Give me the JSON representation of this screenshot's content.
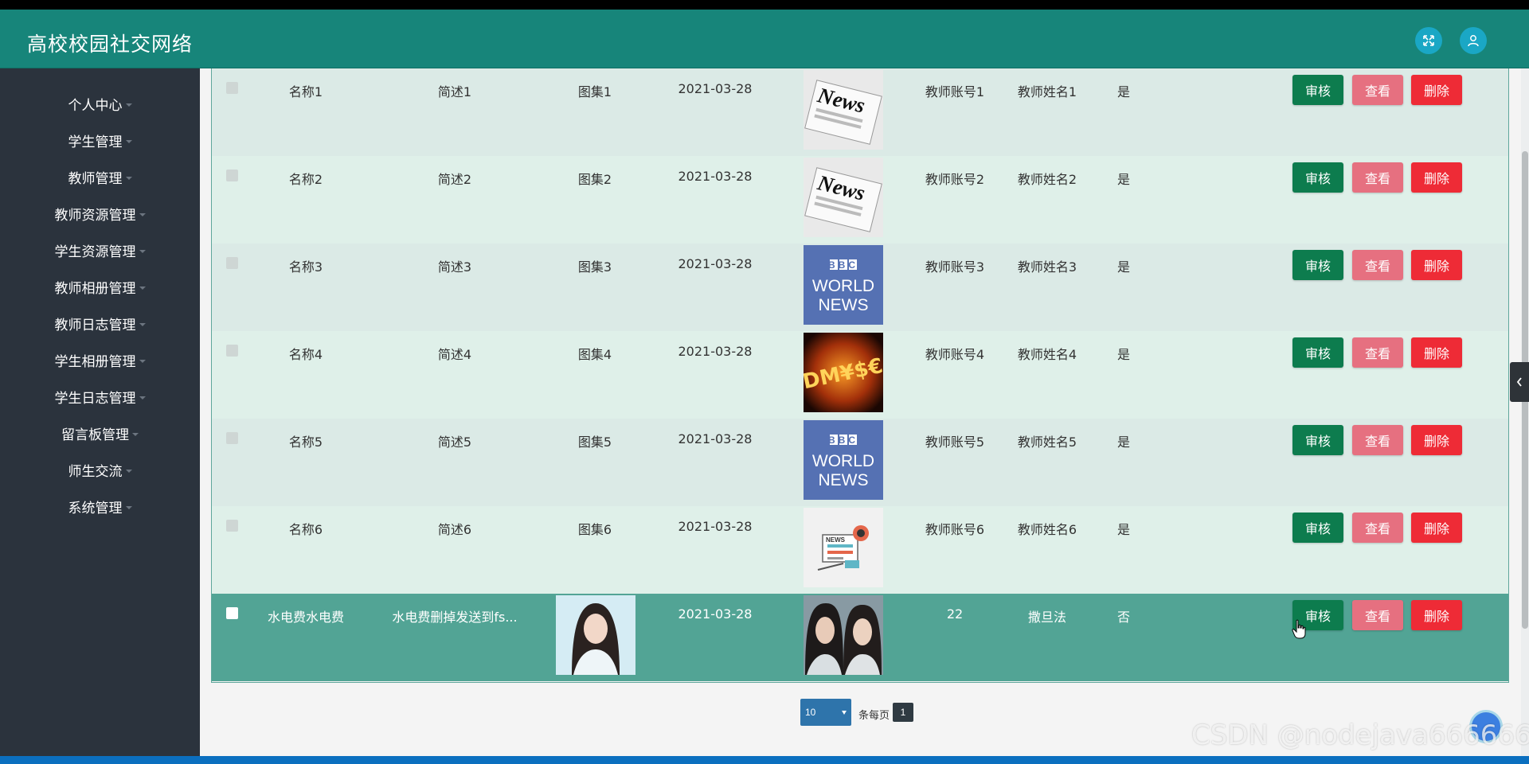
{
  "header": {
    "title": "高校校园社交网络"
  },
  "sidebar": {
    "items": [
      {
        "label": "个人中心"
      },
      {
        "label": "学生管理"
      },
      {
        "label": "教师管理"
      },
      {
        "label": "教师资源管理"
      },
      {
        "label": "学生资源管理"
      },
      {
        "label": "教师相册管理"
      },
      {
        "label": "教师日志管理"
      },
      {
        "label": "学生相册管理"
      },
      {
        "label": "学生日志管理"
      },
      {
        "label": "留言板管理"
      },
      {
        "label": "师生交流"
      },
      {
        "label": "系统管理"
      }
    ]
  },
  "table": {
    "rows": [
      {
        "name": "名称1",
        "brief": "简述1",
        "album": "图集1",
        "date": "2021-03-28",
        "image": "news-paper-image",
        "account": "教师账号1",
        "teacher": "教师姓名1",
        "approved": "是"
      },
      {
        "name": "名称2",
        "brief": "简述2",
        "album": "图集2",
        "date": "2021-03-28",
        "image": "news-paper-image",
        "account": "教师账号2",
        "teacher": "教师姓名2",
        "approved": "是"
      },
      {
        "name": "名称3",
        "brief": "简述3",
        "album": "图集3",
        "date": "2021-03-28",
        "image": "bbc-world-news-image",
        "account": "教师账号3",
        "teacher": "教师姓名3",
        "approved": "是"
      },
      {
        "name": "名称4",
        "brief": "简述4",
        "album": "图集4",
        "date": "2021-03-28",
        "image": "money-fire-image",
        "account": "教师账号4",
        "teacher": "教师姓名4",
        "approved": "是"
      },
      {
        "name": "名称5",
        "brief": "简述5",
        "album": "图集5",
        "date": "2021-03-28",
        "image": "bbc-world-news-image",
        "account": "教师账号5",
        "teacher": "教师姓名5",
        "approved": "是"
      },
      {
        "name": "名称6",
        "brief": "简述6",
        "album": "图集6",
        "date": "2021-03-28",
        "image": "news-illustration-image",
        "account": "教师账号6",
        "teacher": "教师姓名6",
        "approved": "是"
      },
      {
        "name": "水电费水电费",
        "brief": "水电费删掉发送到fs...",
        "album": "",
        "date": "2021-03-28",
        "image": "two-actors-photo",
        "account": "22",
        "teacher": "撒旦法",
        "approved": "否"
      }
    ],
    "actions": {
      "audit": "审核",
      "view": "查看",
      "delete": "删除"
    }
  },
  "bbc": {
    "logo": "BBC",
    "line1": "WORLD",
    "line2": "NEWS"
  },
  "news_word": "News",
  "news_small": "NEWS",
  "money_text": "DM¥$€",
  "pagination": {
    "page_size": "10",
    "per_page_label": "条每页",
    "current_page": "1"
  },
  "watermark": "CSDN @nodejava666666",
  "colors": {
    "header": "#17857a",
    "sidebar": "#2b333d",
    "audit": "#0d7c4e",
    "view": "#e67080",
    "delete": "#ee2b36",
    "highlight_row": "#52a495"
  }
}
